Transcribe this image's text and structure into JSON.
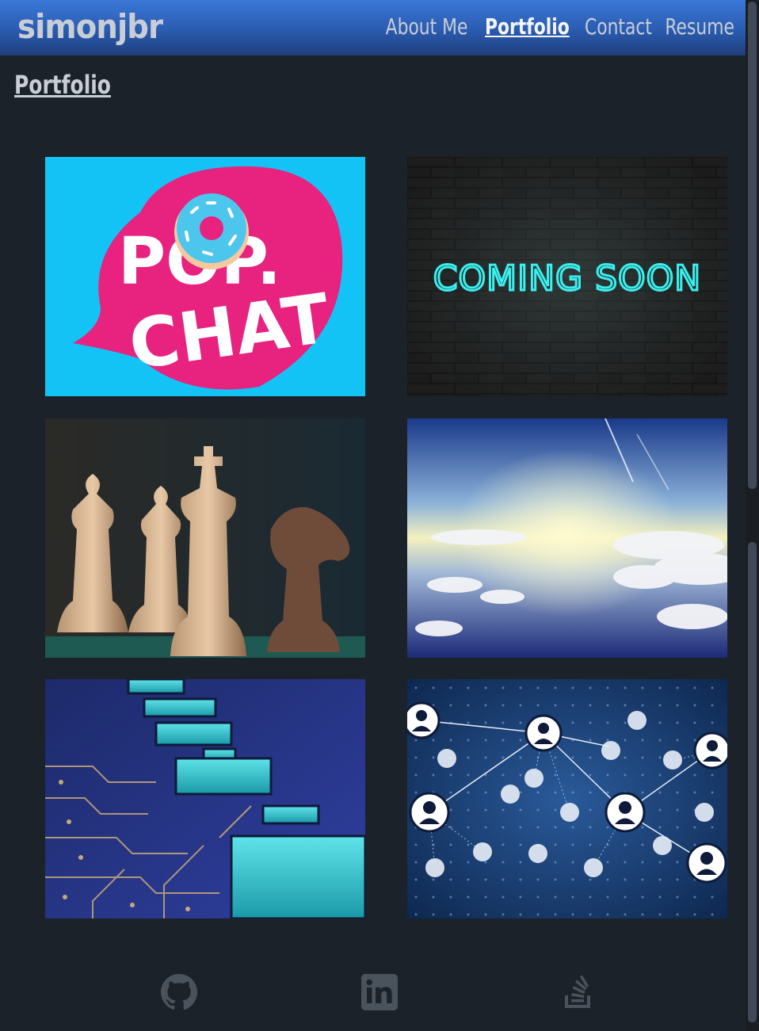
{
  "brand": "simonjbr",
  "nav": [
    {
      "label": "About Me",
      "active": false
    },
    {
      "label": "Portfolio",
      "active": true
    },
    {
      "label": "Contact",
      "active": false
    },
    {
      "label": "Resume",
      "active": false
    }
  ],
  "heading": "Portfolio",
  "projects": [
    {
      "name": "pop-chat",
      "image_text": [
        "POP.",
        "CHAT"
      ],
      "icon": "donut-speech-bubble"
    },
    {
      "name": "coming-soon",
      "image_text": "COMING SOON",
      "icon": "neon-sign-brick-wall"
    },
    {
      "name": "chess",
      "icon": "chess-pieces"
    },
    {
      "name": "clouds",
      "icon": "sky-clouds"
    },
    {
      "name": "circuit-board",
      "icon": "circuit-board"
    },
    {
      "name": "network",
      "icon": "people-network"
    }
  ],
  "footer_links": [
    {
      "name": "github",
      "icon": "github-icon"
    },
    {
      "name": "linkedin",
      "icon": "linkedin-icon"
    },
    {
      "name": "stackoverflow",
      "icon": "stackoverflow-icon"
    }
  ],
  "colors": {
    "background": "#1c2229",
    "navbar": "#2a5bb0",
    "text": "#c9ced6",
    "icon": "#4a525c"
  }
}
